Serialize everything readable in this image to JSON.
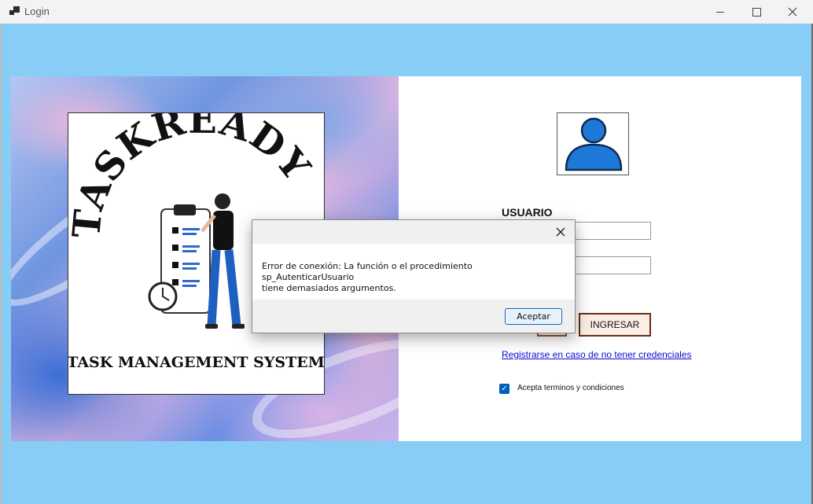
{
  "window": {
    "title": "Login",
    "icon": "app-window-icon"
  },
  "logo": {
    "brand": "TASKREADY",
    "subtitle": "TASK MANAGEMENT SYSTEM"
  },
  "form": {
    "usuario_label": "USUARIO",
    "ingresar_label": "INGRESAR",
    "register_link": "Registrarse en caso de no tener credenciales",
    "terms_label": "Acepta terminos y condiciones",
    "terms_checked": true
  },
  "dialog": {
    "message_line1": "Error de conexión: La función o el procedimiento sp_AutenticarUsuario",
    "message_line2": "tiene demasiados argumentos.",
    "ok_label": "Aceptar"
  },
  "colors": {
    "background": "#87cdf6",
    "accent": "#005fb8",
    "avatar": "#1e78d8"
  }
}
